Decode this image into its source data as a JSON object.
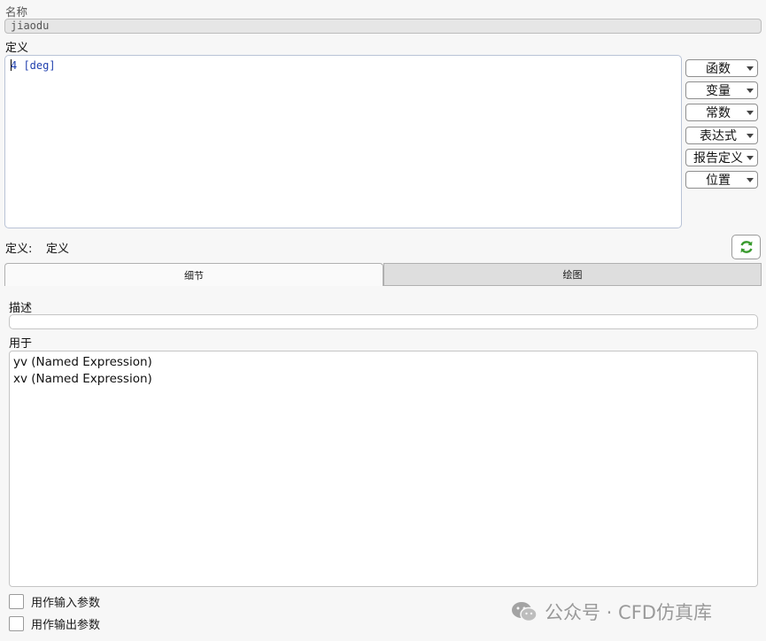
{
  "name": {
    "label": "名称",
    "value": "jiaodu"
  },
  "definition": {
    "label": "定义",
    "value": "4 [deg]"
  },
  "side_buttons": [
    {
      "label": "函数"
    },
    {
      "label": "变量"
    },
    {
      "label": "常数"
    },
    {
      "label": "表达式"
    },
    {
      "label": "报告定义"
    },
    {
      "label": "位置"
    }
  ],
  "status": {
    "label": "定义:",
    "value": "定义"
  },
  "tabs": [
    {
      "label": "细节",
      "active": true
    },
    {
      "label": "绘图",
      "active": false
    }
  ],
  "details": {
    "description_label": "描述",
    "description_value": "",
    "used_in_label": "用于",
    "used_in_items": [
      "yv (Named Expression)",
      "xv (Named Expression)"
    ],
    "checkbox_input": {
      "label": "用作输入参数",
      "checked": false
    },
    "checkbox_output": {
      "label": "用作输出参数",
      "checked": false
    }
  },
  "watermark": {
    "text": "公众号 · CFD仿真库",
    "icon": "wechat-icon"
  },
  "colors": {
    "definition_text": "#1f3fae",
    "refresh_icon": "#3a9b2f"
  }
}
